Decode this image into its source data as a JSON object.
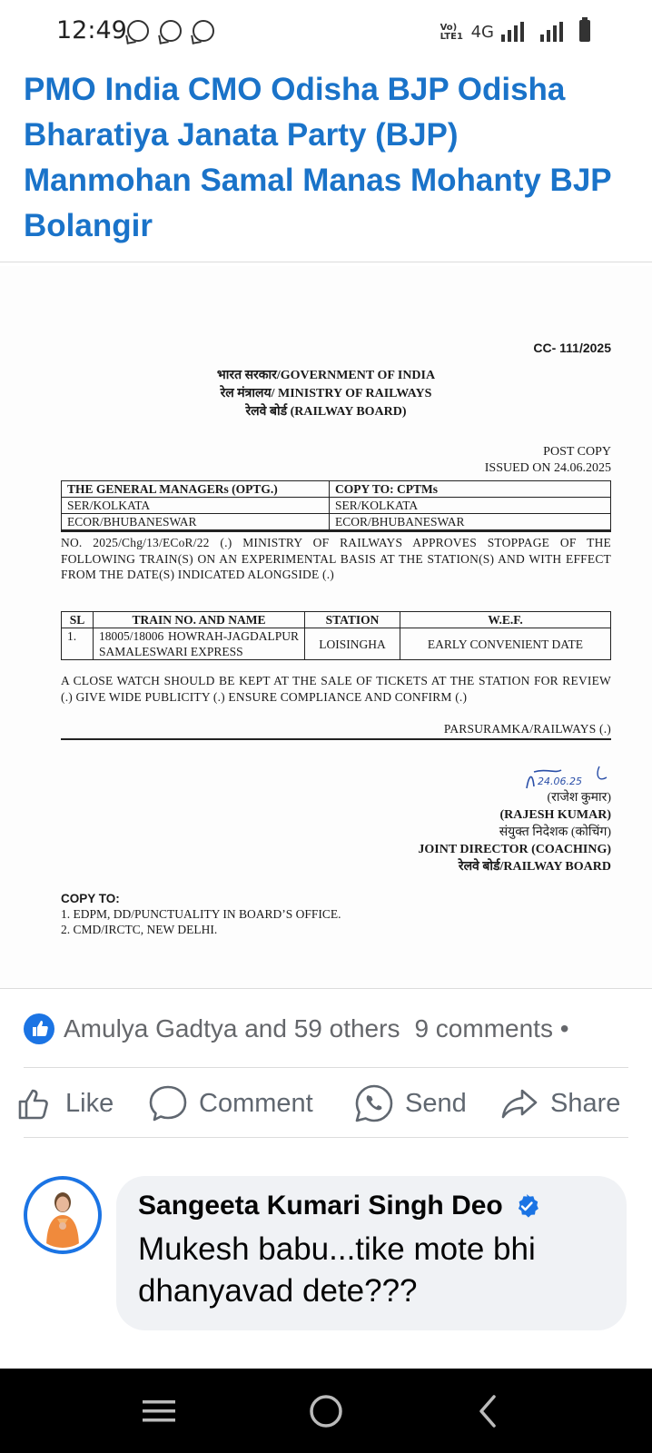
{
  "status_bar": {
    "time": "12:49",
    "volte_label": "Vo) LTE1",
    "network": "4G",
    "app_icons": [
      "whatsapp-business-icon",
      "whatsapp-icon",
      "whatsapp-business-icon"
    ]
  },
  "post": {
    "title": "PMO India CMO Odisha BJP Odisha Bharatiya Janata Party (BJP) Manmohan Samal Manas Mohanty BJP Bolangir"
  },
  "document": {
    "ref": "CC- 111/2025",
    "header_line1": "भारत सरकार/GOVERNMENT OF INDIA",
    "header_line2": "रेल मंत्रालय/ MINISTRY OF RAILWAYS",
    "header_line3": "रेलवे बोर्ड (RAILWAY BOARD)",
    "post_copy": "POST COPY",
    "issued_on": "ISSUED ON  24.06.2025",
    "address_table": {
      "col1_header": "THE GENERAL MANAGERs (OPTG.)",
      "col2_header": "COPY TO: CPTMs",
      "rows": [
        [
          "SER/KOLKATA",
          "SER/KOLKATA"
        ],
        [
          "ECOR/BHUBANESWAR",
          "ECOR/BHUBANESWAR"
        ]
      ]
    },
    "order_text": "NO. 2025/Chg/13/ECoR/22 (.) MINISTRY OF RAILWAYS APPROVES STOPPAGE OF THE FOLLOWING TRAIN(S) ON AN EXPERIMENTAL BASIS AT THE STATION(S) AND WITH EFFECT FROM THE DATE(S) INDICATED ALONGSIDE (.)",
    "train_table": {
      "headers": [
        "SL",
        "TRAIN NO. AND NAME",
        "STATION",
        "W.E.F."
      ],
      "row": {
        "sl": "1.",
        "train": "18005/18006 HOWRAH-JAGDALPUR SAMALESWARI EXPRESS",
        "station": "LOISINGHA",
        "wef": "EARLY CONVENIENT DATE"
      }
    },
    "watch_text": "A CLOSE WATCH SHOULD BE KEPT AT THE SALE OF TICKETS AT THE STATION FOR REVIEW (.) GIVE WIDE PUBLICITY (.) ENSURE COMPLIANCE AND CONFIRM (.)",
    "sender": "PARSURAMKA/RAILWAYS (.)",
    "signature_date": "24.06.25",
    "sign_hindi_name": "(राजेश कुमार)",
    "sign_name": "(RAJESH KUMAR)",
    "sign_hindi_title": "संयुक्त निदेशक (कोचिंग)",
    "sign_title": "JOINT DIRECTOR (COACHING)",
    "sign_org": "रेलवे बोर्ड/RAILWAY BOARD",
    "copy_to_label": "COPY TO:",
    "copy_to_items": [
      "1. EDPM, DD/PUNCTUALITY IN BOARD’S OFFICE.",
      "2. CMD/IRCTC, NEW DELHI."
    ]
  },
  "reactions": {
    "summary": "Amulya Gadtya and 59 others",
    "comments": "9 comments •"
  },
  "actions": {
    "like": "Like",
    "comment": "Comment",
    "send": "Send",
    "share": "Share"
  },
  "comment": {
    "author": "Sangeeta Kumari Singh Deo",
    "text": "Mukesh babu...tike mote bhi dhanyavad dete???"
  },
  "colors": {
    "title_blue": "#1a73c9",
    "fb_blue": "#1b74e4",
    "bubble": "#f0f2f5"
  }
}
